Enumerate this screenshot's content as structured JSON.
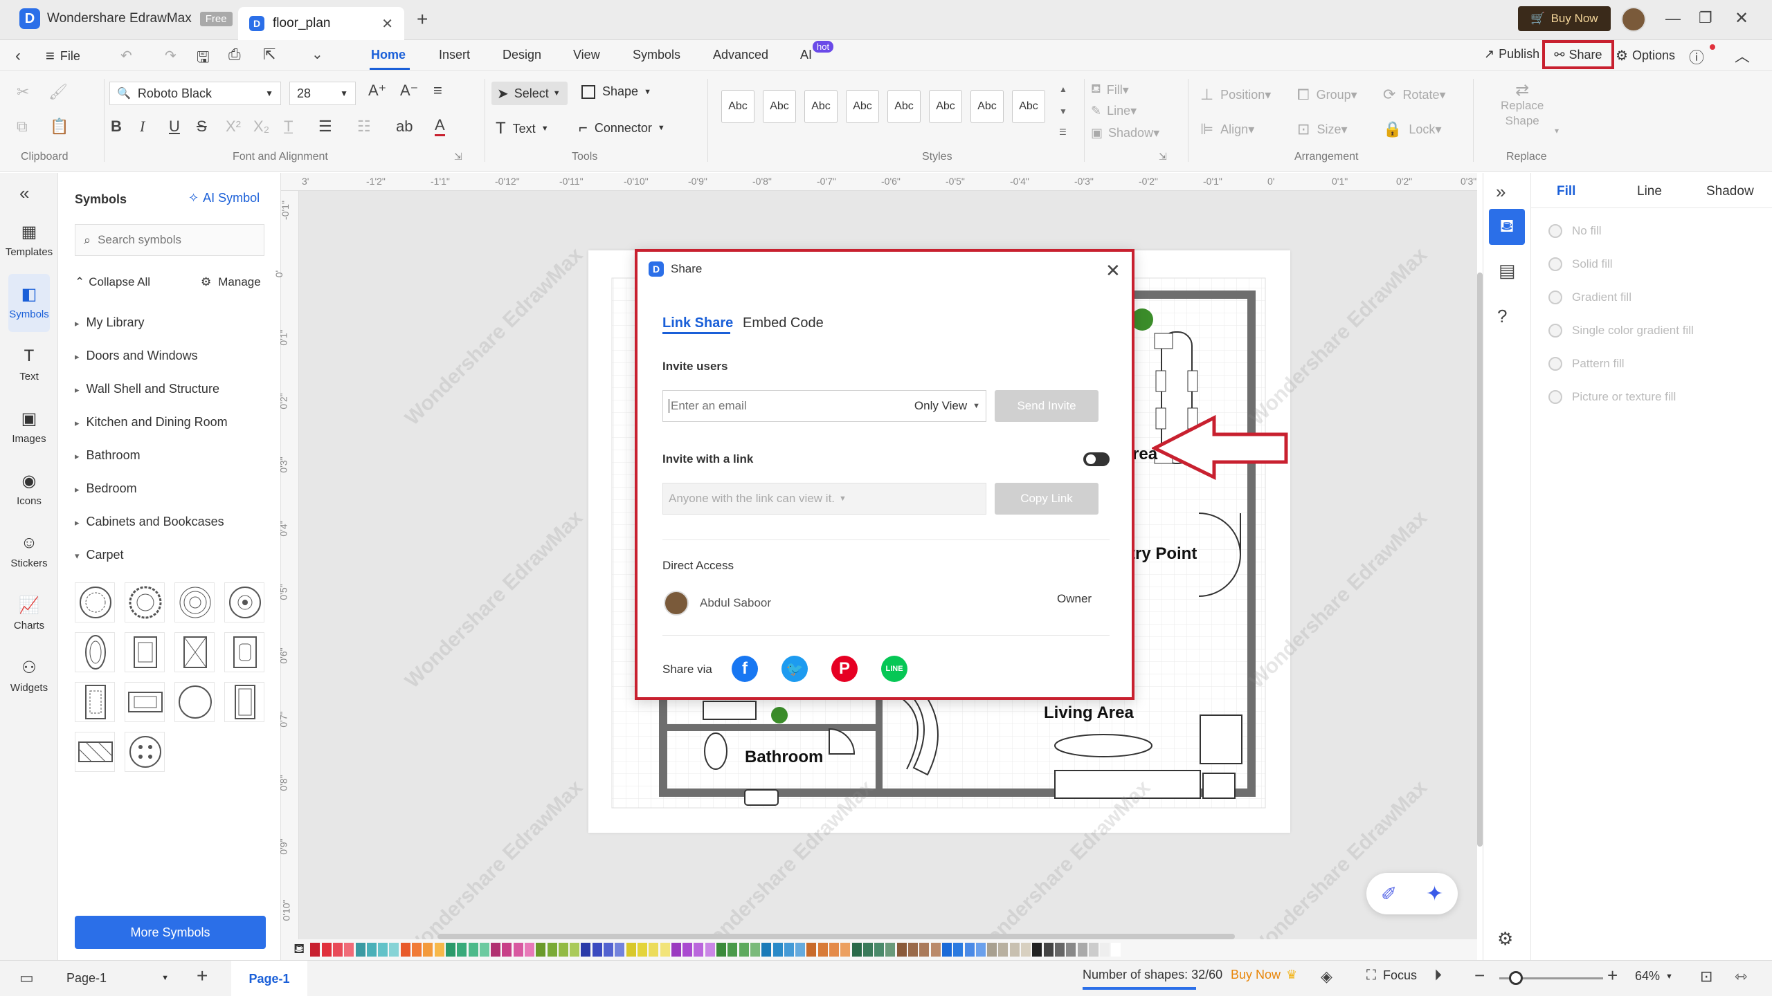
{
  "titlebar": {
    "app_name": "Wondershare EdrawMax",
    "plan_badge": "Free",
    "doc_tab": "floor_plan",
    "buy_now": "Buy Now"
  },
  "menubar": {
    "file": "File",
    "tabs": [
      "Home",
      "Insert",
      "Design",
      "View",
      "Symbols",
      "Advanced",
      "AI"
    ],
    "ai_badge": "hot",
    "publish": "Publish",
    "share": "Share",
    "options": "Options"
  },
  "ribbon": {
    "font_name": "Roboto Black",
    "font_size": "28",
    "select": "Select",
    "shape": "Shape",
    "text": "Text",
    "connector": "Connector",
    "style_sample": "Abc",
    "fill": "Fill",
    "line": "Line",
    "shadow": "Shadow",
    "position": "Position",
    "group": "Group",
    "rotate": "Rotate",
    "align": "Align",
    "size": "Size",
    "lock": "Lock",
    "replace_shape_1": "Replace",
    "replace_shape_2": "Shape",
    "groups": {
      "clipboard": "Clipboard",
      "font": "Font and Alignment",
      "tools": "Tools",
      "styles": "Styles",
      "arrangement": "Arrangement",
      "replace": "Replace"
    }
  },
  "leftnav": [
    {
      "label": "Templates",
      "icon": "templates-icon"
    },
    {
      "label": "Symbols",
      "icon": "symbols-icon"
    },
    {
      "label": "Text",
      "icon": "text-icon"
    },
    {
      "label": "Images",
      "icon": "images-icon"
    },
    {
      "label": "Icons",
      "icon": "icons-icon"
    },
    {
      "label": "Stickers",
      "icon": "stickers-icon"
    },
    {
      "label": "Charts",
      "icon": "charts-icon"
    },
    {
      "label": "Widgets",
      "icon": "widgets-icon"
    }
  ],
  "symbols": {
    "title": "Symbols",
    "ai_symbol": "AI Symbol",
    "search_placeholder": "Search symbols",
    "collapse_all": "Collapse All",
    "manage": "Manage",
    "categories": [
      "My Library",
      "Doors and Windows",
      "Wall Shell and Structure",
      "Kitchen and Dining Room",
      "Bathroom",
      "Bedroom",
      "Cabinets and Bookcases",
      "Carpet"
    ],
    "more_symbols": "More Symbols"
  },
  "ruler": {
    "top": [
      "3'",
      "-1'2\"",
      "-1'1\"",
      "-0'12\"",
      "-0'11\"",
      "-0'10\"",
      "-0'9\"",
      "-0'8\"",
      "-0'7\"",
      "-0'6\"",
      "-0'5\"",
      "-0'4\"",
      "-0'3\"",
      "-0'2\"",
      "-0'1\"",
      "0'",
      "0'1\"",
      "0'2\"",
      "0'3\""
    ],
    "left": [
      "-0'1\"",
      "0'",
      "0'1\"",
      "0'2\"",
      "0'3\"",
      "0'4\"",
      "0'5\"",
      "0'6\"",
      "0'7\"",
      "0'8\"",
      "0'9\"",
      "0'10\""
    ]
  },
  "watermark": "Wondershare EdrawMax",
  "floorplan": {
    "labels": {
      "area": "rea",
      "entry": "try Point",
      "living": "Living Area",
      "bathroom": "Bathroom"
    }
  },
  "dialog": {
    "title": "Share",
    "tabs": [
      "Link Share",
      "Embed Code"
    ],
    "invite_users": "Invite users",
    "email_placeholder": "Enter an email",
    "permission": "Only View",
    "send_invite": "Send Invite",
    "invite_with_link": "Invite with a link",
    "link_placeholder": "Anyone with the link can view it.",
    "copy_link": "Copy Link",
    "direct_access": "Direct Access",
    "user_name": "Abdul Saboor",
    "user_role": "Owner",
    "share_via": "Share via",
    "social": [
      "facebook",
      "twitter",
      "pinterest",
      "line"
    ]
  },
  "rightpanel": {
    "tabs": [
      "Fill",
      "Line",
      "Shadow"
    ],
    "fill_options": [
      "No fill",
      "Solid fill",
      "Gradient fill",
      "Single color gradient fill",
      "Pattern fill",
      "Picture or texture fill"
    ]
  },
  "statusbar": {
    "page_selector": "Page-1",
    "active_page": "Page-1",
    "shape_count": "Number of shapes: 32/60",
    "buy_now": "Buy Now",
    "focus": "Focus",
    "zoom": "64%"
  },
  "colors": {
    "accent": "#1a5fd8",
    "highlight": "#c8202f",
    "palette": [
      "#c8202f",
      "#e0303c",
      "#e84a58",
      "#f06b78",
      "#3a9aa2",
      "#4ab0b8",
      "#62c2c8",
      "#86d3d6",
      "#e85a2a",
      "#f07a36",
      "#f39a3c",
      "#f7b84a",
      "#2a9a6a",
      "#38aa7a",
      "#4cba8a",
      "#6ccaa0",
      "#b03070",
      "#c84088",
      "#d858a0",
      "#e878b8",
      "#6a9a2a",
      "#7aaa36",
      "#92ba44",
      "#aaca5a",
      "#2a3aa8",
      "#3a4ac0",
      "#5262d0",
      "#7282dc",
      "#d8c82a",
      "#e4d43a",
      "#ecdc5a",
      "#f2e47a",
      "#9a3ac0",
      "#aa4ad0",
      "#ba66dc",
      "#ca86e6",
      "#3a8a3a",
      "#4a9a4a",
      "#5eaa5e",
      "#7aba7a",
      "#1a7ab8",
      "#2a8ac8",
      "#449ad6",
      "#64aade",
      "#c86a2a",
      "#d87a36",
      "#e48a48",
      "#eca060",
      "#2a6a4a",
      "#3a7a5a",
      "#4a8a6a",
      "#6a9a7a",
      "#8a5a3a",
      "#9a6a4a",
      "#aa7a5a",
      "#ba8a6a",
      "#1a6ad8",
      "#2a7ae0",
      "#4a8ae6",
      "#6aa0ec",
      "#a8a090",
      "#b8b0a0",
      "#c8c0b0",
      "#d8d0c0",
      "#222222",
      "#444444",
      "#666666",
      "#888888",
      "#aaaaaa",
      "#cccccc",
      "#eeeeee",
      "#ffffff"
    ]
  }
}
